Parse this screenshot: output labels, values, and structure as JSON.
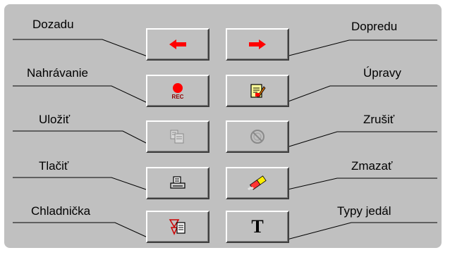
{
  "labels": {
    "back": "Dozadu",
    "forward": "Dopredu",
    "record": "Nahrávanie",
    "edit": "Úpravy",
    "save": "Uložiť",
    "cancel": "Zrušiť",
    "print": "Tlačiť",
    "delete": "Zmazať",
    "fridge": "Chladnička",
    "dish_types": "Typy jedál"
  },
  "icons": {
    "back": "arrow-left-icon",
    "forward": "arrow-right-icon",
    "record": "record-icon",
    "edit": "edit-document-icon",
    "save": "save-icon",
    "cancel": "cancel-icon",
    "print": "printer-icon",
    "delete": "eraser-icon",
    "fridge": "fridge-filter-icon",
    "dish_types": "text-t-icon"
  },
  "icon_text": {
    "rec": "REC",
    "t": "T"
  },
  "states": {
    "save_enabled": false,
    "cancel_enabled": false
  },
  "colors": {
    "panel": "#c0c0c0",
    "arrow_red": "#ff0000",
    "disabled": "#8a8a8a"
  }
}
